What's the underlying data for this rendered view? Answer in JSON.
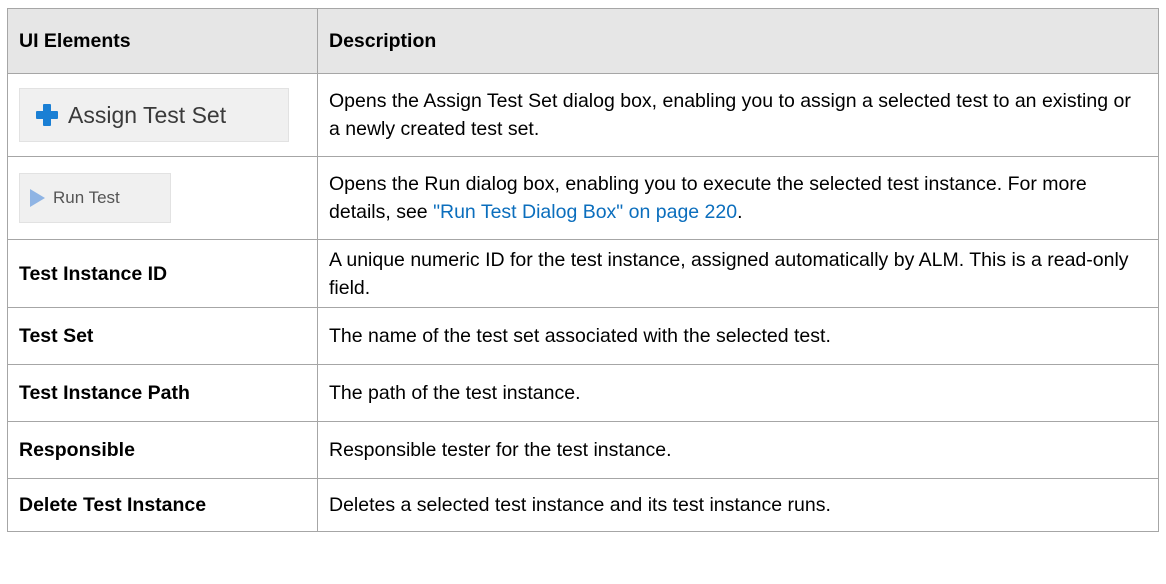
{
  "table": {
    "headers": {
      "col1": "UI Elements",
      "col2": "Description"
    },
    "assign": {
      "button_label": "Assign Test Set",
      "icon": "plus-icon",
      "description": "Opens the Assign Test Set dialog box, enabling you to assign a selected test to an existing or a newly created test set."
    },
    "run": {
      "button_label": "Run Test",
      "icon": "play-icon",
      "description_before": "Opens the Run dialog box, enabling you to execute the selected test instance. For more details, see ",
      "link_text": "\"Run Test Dialog Box\" on page 220",
      "description_after": "."
    },
    "rows": [
      {
        "element": "Test Instance ID",
        "description": "A unique numeric ID for the test instance, assigned automatically by ALM. This is a read-only field."
      },
      {
        "element": "Test Set",
        "description": "The name of the test set associated with the selected test."
      },
      {
        "element": "Test Instance Path",
        "description": "The path of the test instance."
      },
      {
        "element": "Responsible",
        "description": "Responsible tester for the test instance."
      },
      {
        "element": "Delete Test Instance",
        "description": "Deletes a selected test instance and its test instance runs."
      }
    ]
  },
  "colors": {
    "header_bg": "#e6e6e6",
    "border": "#a6a6a6",
    "link": "#0b6ebd",
    "plus_icon": "#1a7fd4",
    "play_icon": "#8fb4e4"
  }
}
